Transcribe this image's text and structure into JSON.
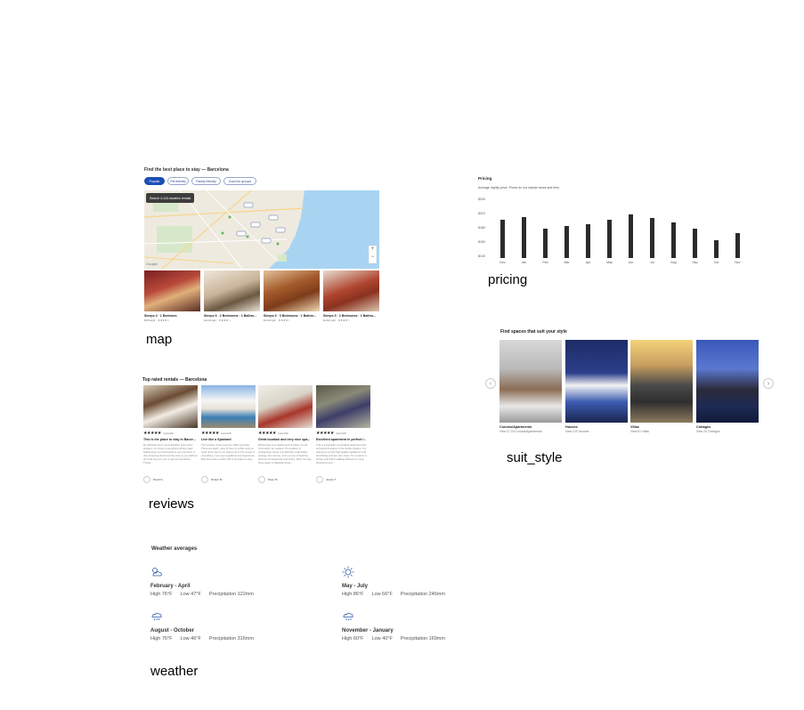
{
  "captions": {
    "map": "map",
    "pricing": "pricing",
    "reviews": "reviews",
    "suit_style": "suit_style",
    "weather": "weather"
  },
  "map_section": {
    "title": "Find the best place to stay — Barcelona",
    "filters": [
      "Popular",
      "Pet friendly",
      "Family friendly",
      "Good for groups"
    ],
    "search_button": "Search 4,143 vacation rentals",
    "map_credit": "Google",
    "zoom_in": "+",
    "zoom_out": "−",
    "rentals": [
      {
        "title": "Sleeps 4 · 1 Bedroom",
        "meta": "$33/night · ★★★★☆"
      },
      {
        "title": "Sleeps 6 · 2 Bedrooms · 1 Bathro...",
        "meta": "$124/night · ★★★★☆"
      },
      {
        "title": "Sleeps 6 · 3 Bedrooms · 1 Bathro...",
        "meta": "$123/night · ★★★★☆"
      },
      {
        "title": "Sleeps 5 · 2 Bedrooms · 1 Bathro...",
        "meta": "$130/night · ★★★★☆"
      }
    ]
  },
  "pricing_section": {
    "title": "Pricing",
    "subtitle": "Average nightly price. Prices do not include taxes and fees."
  },
  "chart_data": {
    "type": "bar",
    "title": "Pricing",
    "categories": [
      "Dec",
      "Jan",
      "Feb",
      "Mar",
      "Apr",
      "May",
      "Jun",
      "Jul",
      "Aug",
      "Sep",
      "Oct",
      "Nov"
    ],
    "values": [
      205,
      210,
      190,
      195,
      197,
      205,
      215,
      208,
      200,
      190,
      170,
      182
    ],
    "yticks": [
      "$240",
      "$210",
      "$180",
      "$160",
      "$140"
    ],
    "ylim": [
      140,
      240
    ]
  },
  "reviews_section": {
    "title": "Top rated rentals — Barcelona",
    "cards": [
      {
        "stars": "★★★★★",
        "date": "September 2019",
        "title": "This is the place to stay in Barce...",
        "body": "My girlfriend and I found fantastic view at the location; it is close to everything all the major sightseeing you would want to see and there is nice shopping all around the area to you walk too and and buys for your to get out and about. Thank...",
        "author": "David G."
      },
      {
        "stars": "★★★★★",
        "date": "September 2019",
        "title": "Live like a Spaniard",
        "body": "The reviews I have read are 100% accurate. There are stairs, uses of them to a little noisy at night. Even (but if you want to be in the center of everything, meet your neighbors and experience Barcelona like a native this is the place to stay...",
        "author": "Robert M."
      },
      {
        "stars": "★★★★★",
        "date": "September 2019",
        "title": "Great location and very nice spa...",
        "body": "Marcel was very helpful and provided you all information we needed. The location is outstanding: Close to la Rambla, Catedralde, cokings, bus service, tours on top of beaches and lots of restaurants and shops. We'd not stay there again in Sagrada house...",
        "author": "Dave M."
      },
      {
        "stars": "★★★★★",
        "date": "September 2019",
        "title": "Excellent apartment in perfect l...",
        "body": "This is a beautiful comfortable apartment with convenient location in the Gothic Quarter. It is well done up with high quality appliances and furnishings and two nice sides. The location is perfect and within walking distance to many attractions and...",
        "author": "Jessie T."
      }
    ]
  },
  "style_section": {
    "title": "Find spaces that suit your style",
    "prev": "‹",
    "next": "›",
    "cards": [
      {
        "title": "Condos/Apartments",
        "sub": "View 3,724 Condos/Apartments"
      },
      {
        "title": "Houses",
        "sub": "View 210 Houses"
      },
      {
        "title": "Villas",
        "sub": "View 61 Villas"
      },
      {
        "title": "Cottages",
        "sub": "View 20 Cottages"
      }
    ]
  },
  "weather_section": {
    "title": "Weather averages",
    "periods": [
      {
        "period": "February - April",
        "high": "High 76°F",
        "low": "Low 47°F",
        "precip": "Precipitation 122mm",
        "icon": "cloud-sun-icon"
      },
      {
        "period": "May - July",
        "high": "High 86°F",
        "low": "Low 66°F",
        "precip": "Precipitation 246mm",
        "icon": "sun-icon"
      },
      {
        "period": "August - October",
        "high": "High 76°F",
        "low": "Low 46°F",
        "precip": "Precipitation 316mm",
        "icon": "rain-cloud-icon"
      },
      {
        "period": "November - January",
        "high": "High 60°F",
        "low": "Low 40°F",
        "precip": "Precipitation 169mm",
        "icon": "snow-cloud-icon"
      }
    ]
  }
}
